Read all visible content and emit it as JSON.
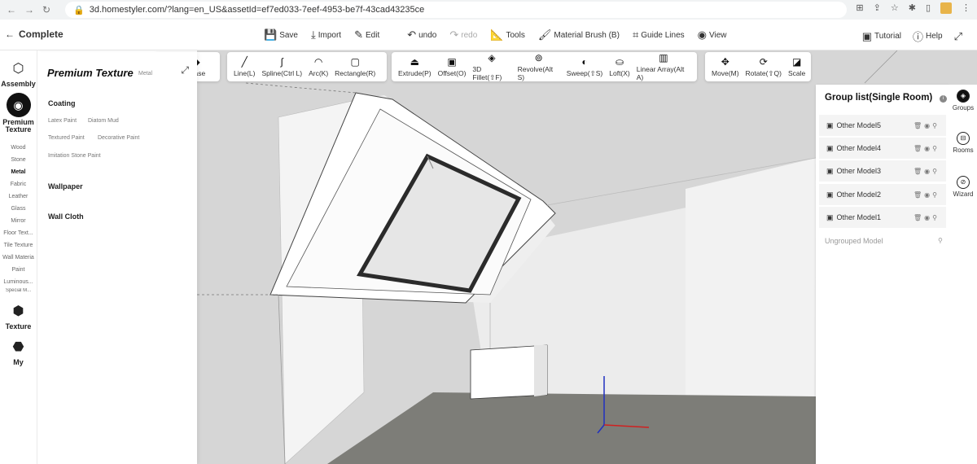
{
  "browser": {
    "url": "3d.homestyler.com/?lang=en_US&assetId=ef7ed033-7eef-4953-be7f-43cad43235ce"
  },
  "topbar": {
    "back_label": "Complete",
    "save": "Save",
    "import": "Import",
    "edit": "Edit",
    "undo": "undo",
    "redo": "redo",
    "tools": "Tools",
    "material_brush": "Material Brush (B)",
    "guide_lines": "Guide Lines",
    "view": "View",
    "tutorial": "Tutorial",
    "help": "Help"
  },
  "rail": {
    "assembly": "Assembly",
    "premium_texture": "Premium Texture",
    "items": [
      "Wood",
      "Stone",
      "Metal",
      "Fabric",
      "Leather",
      "Glass",
      "Mirror",
      "Floor Text...",
      "Tile Texture",
      "Wall Materia",
      "Paint",
      "Luminous...",
      "Special M..."
    ],
    "active_item": "Metal",
    "texture": "Texture",
    "my": "My"
  },
  "panel": {
    "title": "Premium Texture",
    "subtitle": "Metal",
    "coating": "Coating",
    "coating_links": [
      "Latex Paint",
      "Diatom Mud",
      "Textured Paint",
      "Decorative Paint",
      "Imitation Stone Paint"
    ],
    "wallpaper": "Wallpaper",
    "wall_cloth": "Wall Cloth"
  },
  "toolbar1": {
    "erase": "Erase",
    "line": "Line(L)",
    "spline": "Spline(Ctrl L)",
    "arc": "Arc(K)",
    "rectangle": "Rectangle(R)"
  },
  "toolbar2": {
    "extrude": "Extrude(P)",
    "offset": "Offset(O)",
    "fillet": "3D Fillet(⇧F)",
    "revolve": "Revolve(Alt S)",
    "sweep": "Sweep(⇧S)",
    "loft": "Loft(X)",
    "linear_array": "Linear Array(Alt A)"
  },
  "toolbar3": {
    "move": "Move(M)",
    "rotate": "Rotate(⇧Q)",
    "scale": "Scale"
  },
  "groups": {
    "title": "Group list(Single Room)",
    "models": [
      "Other Model5",
      "Other Model4",
      "Other Model3",
      "Other Model2",
      "Other Model1"
    ],
    "ungrouped": "Ungrouped Model"
  },
  "right_rail": {
    "groups": "Groups",
    "rooms": "Rooms",
    "wizard": "Wizard"
  },
  "colors": {
    "viewport_bg": "#dadada",
    "floor": "#7a7a75",
    "window_frame": "#2b2b2b",
    "axis_x": "#d02020",
    "axis_y": "#2030c0",
    "axis_z": "#2030c0"
  }
}
